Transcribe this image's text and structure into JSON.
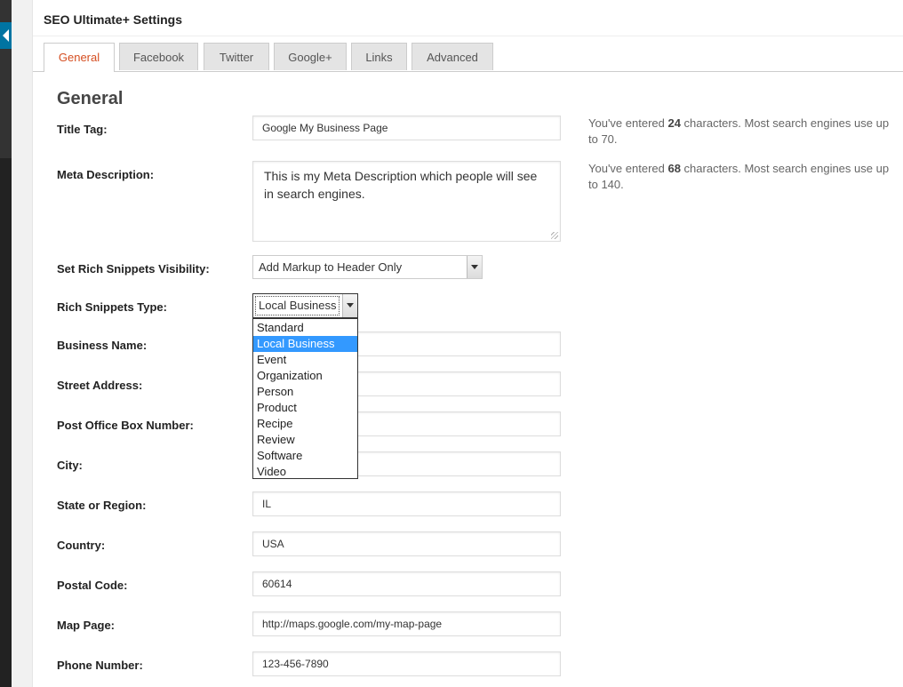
{
  "panel": {
    "title": "SEO Ultimate+ Settings"
  },
  "tabs": [
    {
      "label": "General",
      "active": true
    },
    {
      "label": "Facebook"
    },
    {
      "label": "Twitter"
    },
    {
      "label": "Google+"
    },
    {
      "label": "Links"
    },
    {
      "label": "Advanced"
    }
  ],
  "section": {
    "title": "General"
  },
  "form": {
    "title_tag": {
      "label": "Title Tag:",
      "value": "Google My Business  Page",
      "hint_pre": "You've entered ",
      "hint_count": "24",
      "hint_post": " characters. Most search engines use up to 70."
    },
    "meta_description": {
      "label": "Meta Description:",
      "value": "This is my Meta Description which people will see in search engines.",
      "hint_pre": "You've entered ",
      "hint_count": "68",
      "hint_post": " characters. Most search engines use up to 140."
    },
    "rich_visibility": {
      "label": "Set Rich Snippets Visibility:",
      "value": "Add Markup to Header Only"
    },
    "rich_type": {
      "label": "Rich Snippets Type:",
      "value": "Local Business",
      "options": [
        "Standard",
        "Local Business",
        "Event",
        "Organization",
        "Person",
        "Product",
        "Recipe",
        "Review",
        "Software",
        "Video"
      ],
      "selected_index": 1
    },
    "business_name": {
      "label": "Business Name:",
      "value": ""
    },
    "street_address": {
      "label": "Street Address:",
      "value": ""
    },
    "po_box": {
      "label": "Post Office Box Number:",
      "value": ""
    },
    "city": {
      "label": "City:",
      "value": ""
    },
    "state": {
      "label": "State or Region:",
      "value": "IL"
    },
    "country": {
      "label": "Country:",
      "value": "USA"
    },
    "postal_code": {
      "label": "Postal Code:",
      "value": "60614"
    },
    "map_page": {
      "label": "Map Page:",
      "value": "http://maps.google.com/my-map-page"
    },
    "phone": {
      "label": "Phone Number:",
      "value": "123-456-7890"
    }
  },
  "colors": {
    "accent_tab": "#d54e21",
    "highlight": "#3399ff",
    "admin_blue": "#0074a2"
  }
}
